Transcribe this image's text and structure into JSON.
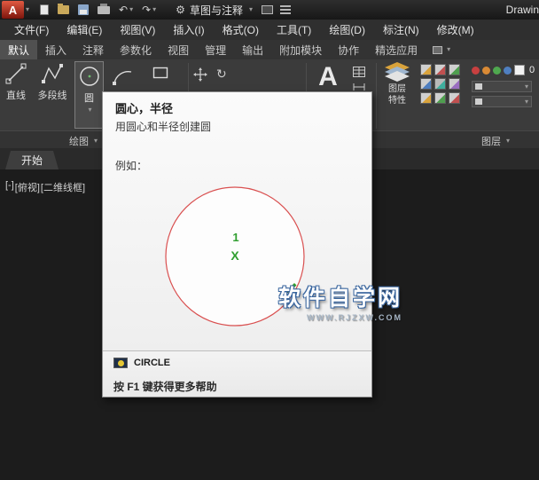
{
  "titlebar": {
    "logo": "A",
    "workspace": "草图与注释",
    "doc_title": "Drawin"
  },
  "menubar": {
    "items": [
      "文件(F)",
      "编辑(E)",
      "视图(V)",
      "插入(I)",
      "格式(O)",
      "工具(T)",
      "绘图(D)",
      "标注(N)",
      "修改(M)"
    ]
  },
  "ribbon": {
    "tabs": [
      {
        "label": "默认"
      },
      {
        "label": "插入"
      },
      {
        "label": "注释"
      },
      {
        "label": "参数化"
      },
      {
        "label": "视图"
      },
      {
        "label": "管理"
      },
      {
        "label": "输出"
      },
      {
        "label": "附加模块"
      },
      {
        "label": "协作"
      },
      {
        "label": "精选应用"
      }
    ],
    "tools": {
      "line": "直线",
      "polyline": "多段线",
      "circle": "圆",
      "text": "A"
    },
    "layer_properties": "图层特性",
    "layer_name": "0",
    "panels": {
      "draw": "绘图",
      "layers": "图层"
    }
  },
  "file_tabs": {
    "start": "开始"
  },
  "viewport": {
    "controls": [
      "[-]",
      "[俯视]",
      "[二维线框]"
    ]
  },
  "tooltip": {
    "title": "圆心，半径",
    "description": "用圆心和半径创建圆",
    "example_label": "例如：",
    "radius_marker": "1",
    "center_marker": "X",
    "command_name": "CIRCLE",
    "help_text": "按 F1 键获得更多帮助"
  },
  "watermark": {
    "line1": "软件自学网",
    "line2": "WWW.RJZXW.COM"
  },
  "icons": {
    "caret_down": "▾",
    "gear": "⚙",
    "undo": "↶",
    "redo": "↷",
    "rotate": "↻"
  },
  "colors": {
    "circle_stroke": "#d94f4f",
    "marker_green": "#2f9e2f",
    "logo_red": "#b2341f"
  }
}
